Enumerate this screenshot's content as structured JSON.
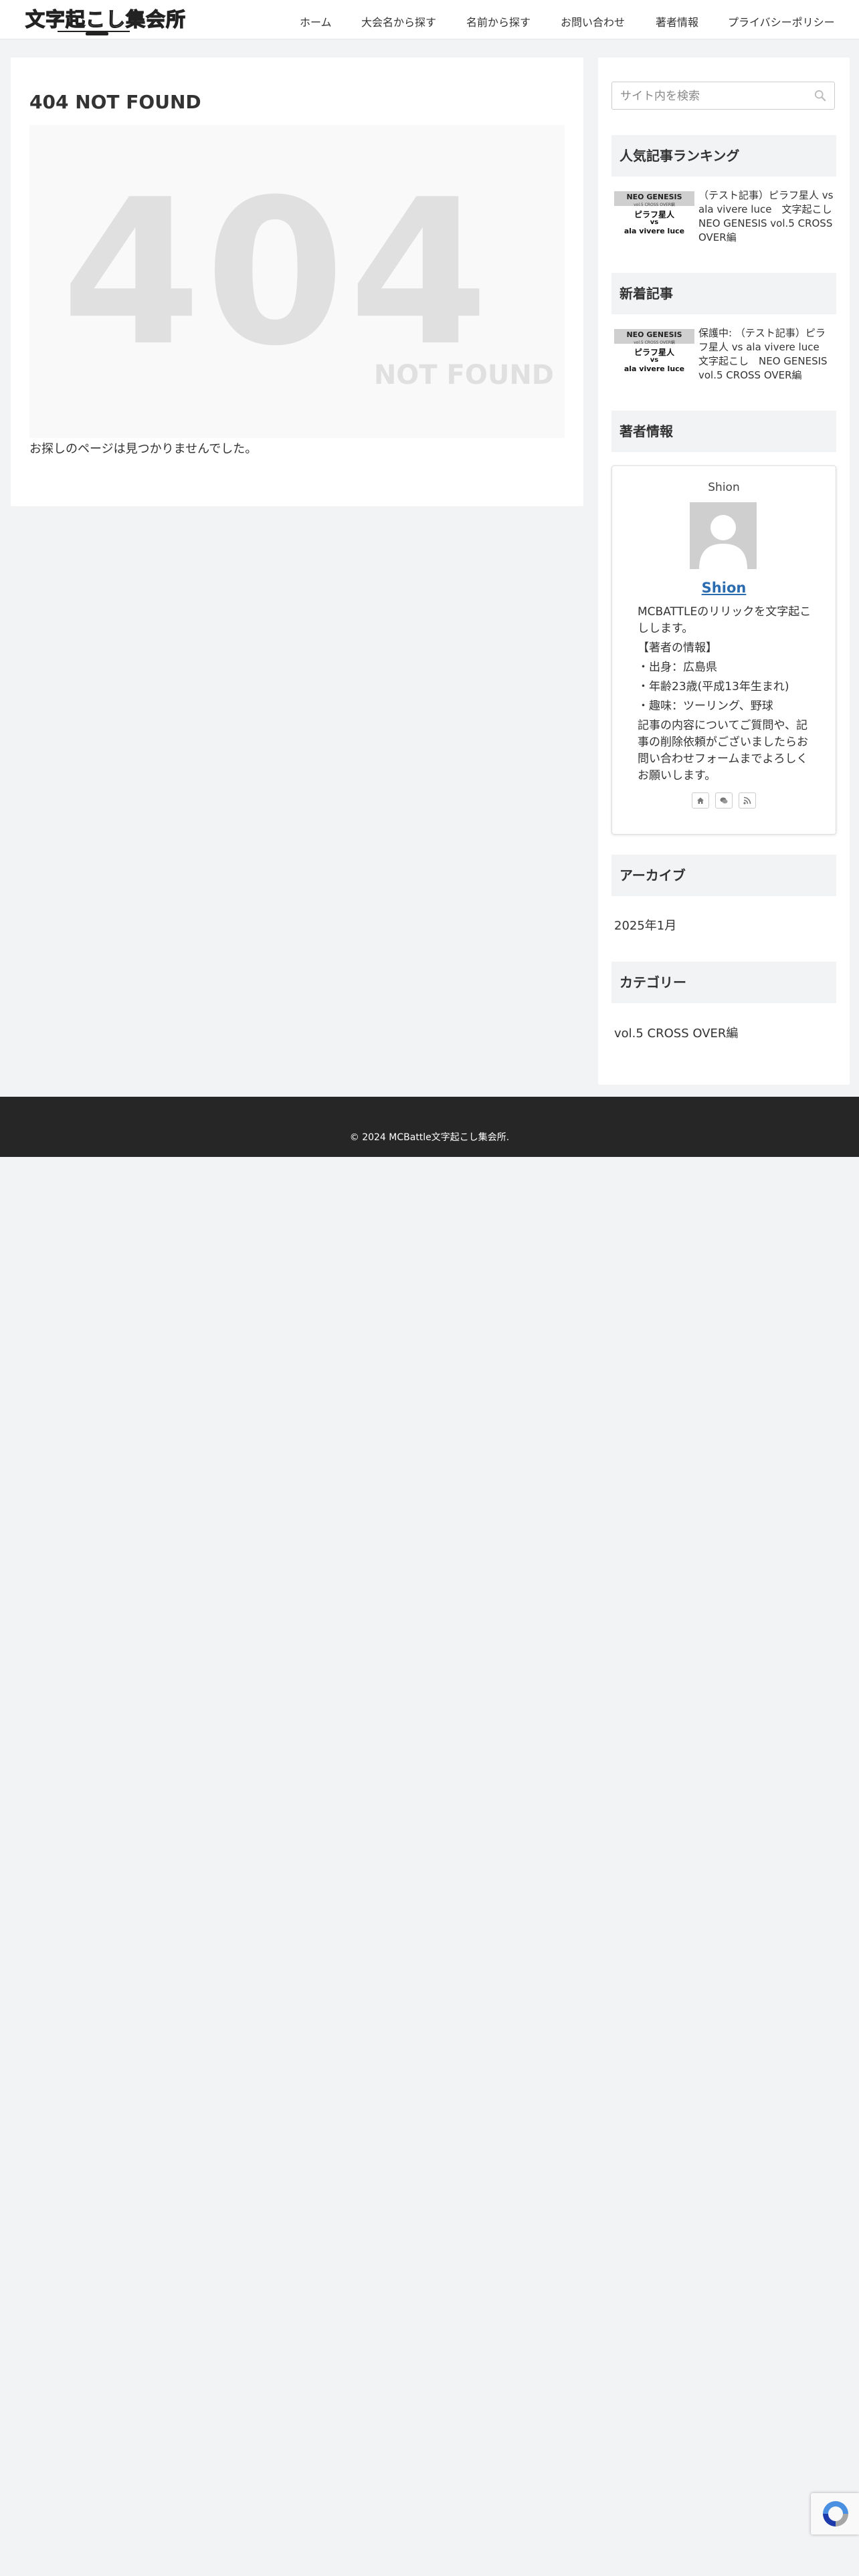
{
  "site": {
    "logo_text": "文字起こし集会所",
    "nav": [
      "ホーム",
      "大会名から探す",
      "名前から探す",
      "お問い合わせ",
      "著者情報",
      "プライバシーポリシー"
    ]
  },
  "main": {
    "title": "404 NOT FOUND",
    "image_digits": "404",
    "image_sub": "NOT FOUND",
    "message": "お探しのページは見つかりませんでした。"
  },
  "sidebar": {
    "search_placeholder": "サイト内を検索",
    "popular": {
      "heading": "人気記事ランキング",
      "items": [
        {
          "title": "（テスト記事）ピラフ星人 vs ala vivere luce　文字起こし　NEO GENESIS vol.5 CROSS OVER編",
          "thumb": {
            "line1": "NEO GENESIS",
            "line2": "vol.5 CROSS OVER編",
            "line3": "ピラフ星人",
            "line4": "vs",
            "line5": "ala vivere luce"
          }
        }
      ]
    },
    "recent": {
      "heading": "新着記事",
      "items": [
        {
          "title": "保護中: （テスト記事）ピラフ星人 vs ala vivere luce　文字起こし　NEO GENESIS vol.5 CROSS OVER編",
          "thumb": {
            "line1": "NEO GENESIS",
            "line2": "vol.5 CROSS OVER編",
            "line3": "ピラフ星人",
            "line4": "vs",
            "line5": "ala vivere luce"
          }
        }
      ]
    },
    "author": {
      "heading": "著者情報",
      "name_top": "Shion",
      "name_link": "Shion",
      "bio": [
        "MCBATTLEのリリックを文字起こしします。",
        "【著者の情報】",
        "・出身：広島県",
        "・年齢23歳(平成13年生まれ)",
        "・趣味：ツーリング、野球",
        "記事の内容についてご質問や、記事の削除依頼がございましたらお問い合わせフォームまでよろしくお願いします。"
      ],
      "icons": [
        "home-icon",
        "comments-icon",
        "rss-icon"
      ]
    },
    "archive": {
      "heading": "アーカイブ",
      "items": [
        "2025年1月"
      ]
    },
    "category": {
      "heading": "カテゴリー",
      "items": [
        "vol.5 CROSS OVER編"
      ]
    }
  },
  "footer": {
    "copyright": "© 2024 MCBattle文字起こし集会所."
  }
}
